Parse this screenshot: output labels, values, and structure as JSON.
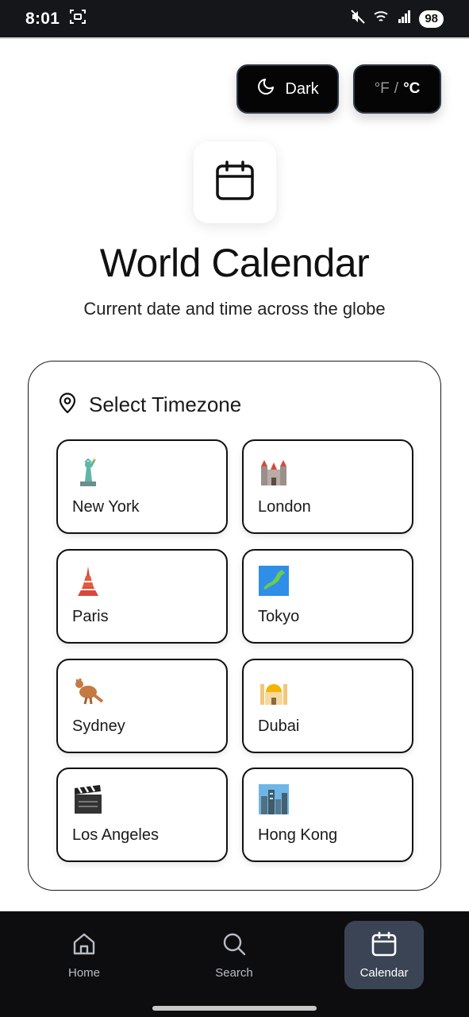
{
  "status_bar": {
    "time": "8:01",
    "battery": "98"
  },
  "toolbar": {
    "theme_label": "Dark",
    "unit_f": "°F",
    "unit_separator": "/",
    "unit_c": "°C"
  },
  "header": {
    "title": "World Calendar",
    "subtitle": "Current date and time across the globe"
  },
  "timezone_panel": {
    "heading": "Select Timezone",
    "cities": [
      {
        "name": "New York",
        "icon": "statue-of-liberty-icon"
      },
      {
        "name": "London",
        "icon": "castle-icon"
      },
      {
        "name": "Paris",
        "icon": "tower-icon"
      },
      {
        "name": "Tokyo",
        "icon": "japan-map-icon"
      },
      {
        "name": "Sydney",
        "icon": "kangaroo-icon"
      },
      {
        "name": "Dubai",
        "icon": "mosque-icon"
      },
      {
        "name": "Los Angeles",
        "icon": "clapper-board-icon"
      },
      {
        "name": "Hong Kong",
        "icon": "cityscape-icon"
      }
    ]
  },
  "bottom_nav": {
    "items": [
      {
        "label": "Home",
        "icon": "home-icon"
      },
      {
        "label": "Search",
        "icon": "search-icon"
      },
      {
        "label": "Calendar",
        "icon": "calendar-icon",
        "active": true
      }
    ]
  },
  "colors": {
    "accent_dark": "#050505",
    "nav_active_bg": "#3b4454",
    "nav_bg": "#0d0d0f"
  }
}
